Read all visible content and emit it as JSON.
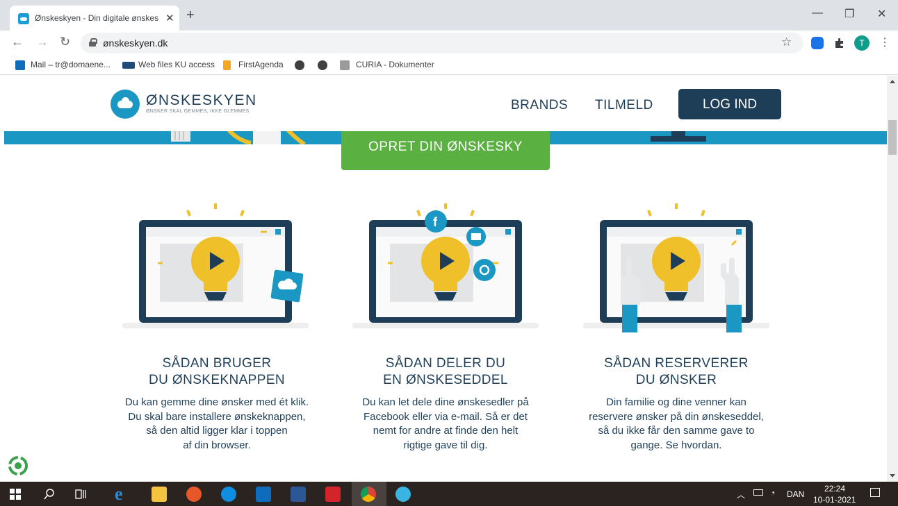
{
  "browser": {
    "tab_title": "Ønskeskyen - Din digitale ønskes",
    "tab_close": "✕",
    "new_tab": "+",
    "url": "ønskeskyen.dk",
    "win_min": "—",
    "win_restore": "❐",
    "win_close": "✕",
    "back": "←",
    "forward": "→",
    "reload": "↻",
    "star": "☆",
    "profile_letter": "T",
    "menu": "⋮"
  },
  "bookmarks": [
    {
      "label": "Mail – tr@domaene...",
      "icon": "outlook-icon",
      "color": "#0f6cbd"
    },
    {
      "label": "Web files KU access",
      "icon": "ku-icon",
      "color": "#1e4a7a"
    },
    {
      "label": "FirstAgenda",
      "icon": "firstagenda-icon",
      "color": "#f5a623"
    },
    {
      "label": "",
      "icon": "globe-icon",
      "color": "#3c4043"
    },
    {
      "label": "",
      "icon": "globe-icon",
      "color": "#3c4043"
    },
    {
      "label": "CURIA - Dokumenter",
      "icon": "curia-icon",
      "color": "#8a8a8a"
    }
  ],
  "site": {
    "logo_name": "ØNSKESKYEN",
    "logo_tagline": "ØNSKER SKAL GEMMES, IKKE GLEMMES",
    "nav": {
      "brands": "BRANDS",
      "signup": "TILMELD",
      "login": "LOG IND"
    },
    "cta": "OPRET DIN ØNSKESKY",
    "colors": {
      "brand_blue": "#1a97c2",
      "navy": "#1e3d57",
      "green": "#5bb042",
      "bulb_yellow": "#f0c02a"
    }
  },
  "features": [
    {
      "title_line1": "SÅDAN BRUGER",
      "title_line2": "DU ØNSKEKNAPPEN",
      "desc": [
        "Du kan gemme dine ønsker med ét klik.",
        "Du skal bare installere ønskeknappen,",
        "så den altid ligger klar i toppen",
        "af din browser."
      ]
    },
    {
      "title_line1": "SÅDAN DELER DU",
      "title_line2": "EN ØNSKESEDDEL",
      "desc": [
        "Du kan let dele dine ønskesedler på",
        "Facebook eller via e-mail. Så er det",
        "nemt for andre at finde den helt",
        "rigtige gave til dig."
      ]
    },
    {
      "title_line1": "SÅDAN RESERVERER",
      "title_line2": "DU ØNSKER",
      "desc": [
        "Din familie og dine venner kan",
        "reservere ønsker på din ønskeseddel,",
        "så du ikke får den samme gave to",
        "gange. Se hvordan."
      ]
    }
  ],
  "taskbar": {
    "language": "DAN",
    "time": "22:24",
    "date": "10-01-2021"
  }
}
